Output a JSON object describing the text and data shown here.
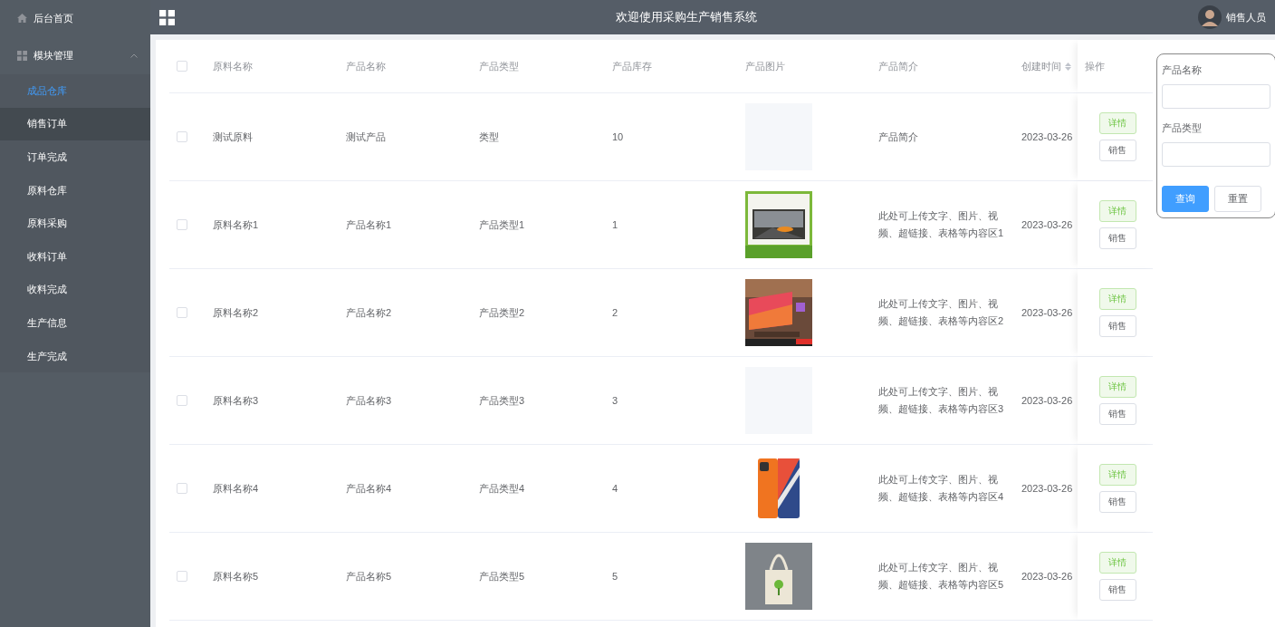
{
  "sidebar": {
    "items": [
      {
        "label": "后台首页",
        "kind": "home"
      },
      {
        "label": "模块管理",
        "kind": "group",
        "expanded": true,
        "children": [
          {
            "label": "成品仓库",
            "selected": true,
            "hovered": false
          },
          {
            "label": "销售订单",
            "selected": false,
            "hovered": true
          },
          {
            "label": "订单完成",
            "selected": false,
            "hovered": false
          },
          {
            "label": "原料仓库",
            "selected": false,
            "hovered": false
          },
          {
            "label": "原料采购",
            "selected": false,
            "hovered": false
          },
          {
            "label": "收料订单",
            "selected": false,
            "hovered": false
          },
          {
            "label": "收料完成",
            "selected": false,
            "hovered": false
          },
          {
            "label": "生产信息",
            "selected": false,
            "hovered": false
          },
          {
            "label": "生产完成",
            "selected": false,
            "hovered": false
          }
        ]
      }
    ]
  },
  "header": {
    "title": "欢迎使用采购生产销售系统",
    "user": "销售人员"
  },
  "table": {
    "all_checked": false,
    "columns": [
      {
        "label": "原料名称",
        "sortable": false
      },
      {
        "label": "产品名称",
        "sortable": false
      },
      {
        "label": "产品类型",
        "sortable": false
      },
      {
        "label": "产品库存",
        "sortable": false
      },
      {
        "label": "产品图片",
        "sortable": false
      },
      {
        "label": "产品简介",
        "sortable": false
      },
      {
        "label": "创建时间",
        "sortable": true
      },
      {
        "label": "操作",
        "sortable": false
      }
    ],
    "rows": [
      {
        "checked": false,
        "material": "测试原料",
        "product": "测试产品",
        "type": "类型",
        "stock": "10",
        "image": {
          "kind": "empty"
        },
        "intro": "产品简介",
        "date": "2023-03-26",
        "actions": [
          "详情",
          "销售"
        ]
      },
      {
        "checked": false,
        "material": "原料名称1",
        "product": "产品名称1",
        "type": "产品类型1",
        "stock": "1",
        "intro": "此处可上传文字、图片、视频、超链接、表格等内容区1",
        "date": "2023-03-26",
        "actions": [
          "详情",
          "销售"
        ]
      },
      {
        "checked": false,
        "material": "原料名称2",
        "product": "产品名称2",
        "type": "产品类型2",
        "stock": "2",
        "intro": "此处可上传文字、图片、视频、超链接、表格等内容区2",
        "date": "2023-03-26",
        "actions": [
          "详情",
          "销售"
        ]
      },
      {
        "checked": false,
        "material": "原料名称3",
        "product": "产品名称3",
        "type": "产品类型3",
        "stock": "3",
        "image": {
          "kind": "empty"
        },
        "intro": "此处可上传文字、图片、视频、超链接、表格等内容区3",
        "date": "2023-03-26",
        "actions": [
          "详情",
          "销售"
        ]
      },
      {
        "checked": false,
        "material": "原料名称4",
        "product": "产品名称4",
        "type": "产品类型4",
        "stock": "4",
        "intro": "此处可上传文字、图片、视频、超链接、表格等内容区4",
        "date": "2023-03-26",
        "actions": [
          "详情",
          "销售"
        ]
      },
      {
        "checked": false,
        "material": "原料名称5",
        "product": "产品名称5",
        "type": "产品类型5",
        "stock": "5",
        "intro": "此处可上传文字、图片、视频、超链接、表格等内容区5",
        "date": "2023-03-26",
        "actions": [
          "详情",
          "销售"
        ]
      }
    ]
  },
  "search": {
    "fields": [
      {
        "label": "产品名称"
      },
      {
        "label": "产品类型"
      }
    ],
    "buttons": [
      {
        "label": "查询",
        "kind": "primary"
      },
      {
        "label": "重置",
        "kind": "default"
      }
    ]
  }
}
